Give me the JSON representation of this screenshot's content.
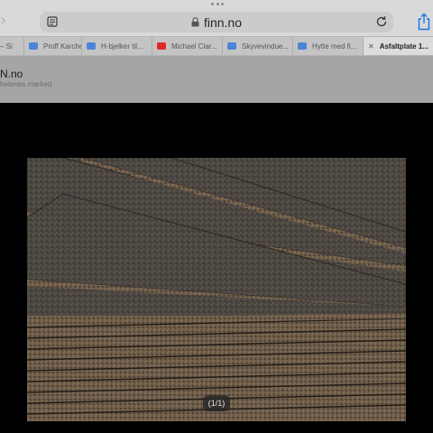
{
  "browser": {
    "url": "finn.no",
    "tabs": [
      {
        "label": "– Si",
        "favicon": "none",
        "favicon_color": "#c4c4c4"
      },
      {
        "label": "Proff Karche...",
        "favicon": "folder-icon",
        "favicon_color": "#4a86d8"
      },
      {
        "label": "H-bjelker til...",
        "favicon": "folder-icon",
        "favicon_color": "#4a86d8"
      },
      {
        "label": "Michael Clar...",
        "favicon": "youtube-icon",
        "favicon_color": "#e02828"
      },
      {
        "label": "Skyvevindue...",
        "favicon": "folder-icon",
        "favicon_color": "#4a86d8"
      },
      {
        "label": "Hytte med fi...",
        "favicon": "folder-icon",
        "favicon_color": "#4a86d8"
      },
      {
        "label": "Asfaltplate 1...",
        "favicon": "close-icon",
        "active": true
      }
    ]
  },
  "page": {
    "site_title": "N.no",
    "site_subtitle": "hetenes marked"
  },
  "viewer": {
    "counter": "(1/1)",
    "image": "stacked-asphalt-fiberboard-sheets"
  },
  "colors": {
    "accent": "#1a73e8",
    "board_dark": "#2f2b27",
    "board_edge": "#6b5a47"
  }
}
